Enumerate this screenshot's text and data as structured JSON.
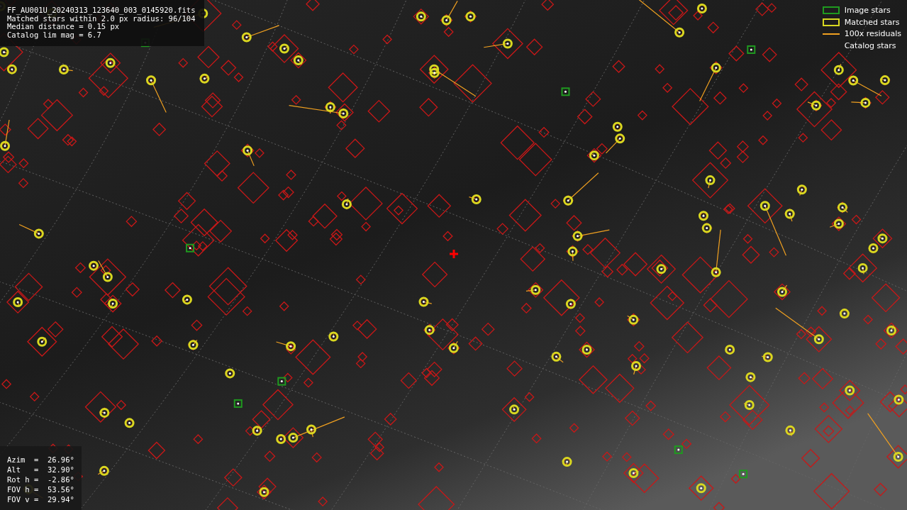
{
  "info": {
    "lines": [
      "FF_AU001U_20240313_123640_003_0145920.fits",
      "Matched stars within 2.0 px radius: 96/104",
      "Median distance = 0.15 px",
      "Catalog lim mag = 6.7"
    ]
  },
  "legend": [
    {
      "kind": "image",
      "label": "Image stars",
      "color": "#1f9a1f"
    },
    {
      "kind": "matched",
      "label": "Matched stars",
      "color": "#d8d820"
    },
    {
      "kind": "residual",
      "label": "100x residuals",
      "color": "#f0a020"
    },
    {
      "kind": "catalog",
      "label": "Catalog stars"
    }
  ],
  "pointing": {
    "lines": [
      "Azim  =  26.96°",
      "Alt   =  32.90°",
      "Rot h =  -2.86°",
      "FOV h =  53.56°",
      "FOV v =  29.94°"
    ]
  }
}
